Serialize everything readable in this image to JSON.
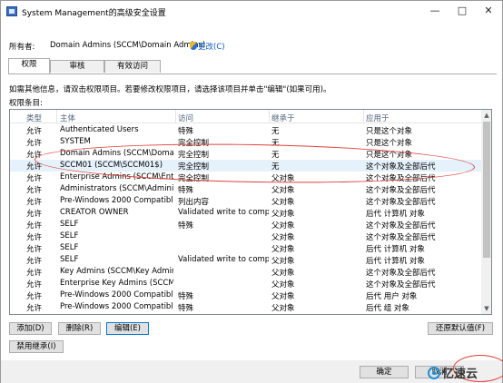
{
  "window": {
    "title": "System Management的高级安全设置"
  },
  "owner": {
    "label": "所有者:",
    "value": "Domain Admins (SCCM\\Domain Admins)",
    "change_link": "更改(C)"
  },
  "tabs": [
    "权限",
    "审核",
    "有效访问"
  ],
  "info_text": "如需其他信息，请双击权限项目。若要修改权限项目，请选择该项目并单击\"编辑\"(如果可用)。",
  "entries_label": "权限条目:",
  "columns": [
    "类型",
    "主体",
    "访问",
    "继承于",
    "应用于"
  ],
  "rows": [
    {
      "type": "允许",
      "principal": "Authenticated Users",
      "access": "特殊",
      "inherited": "无",
      "applies": "只是这个对象"
    },
    {
      "type": "允许",
      "principal": "SYSTEM",
      "access": "完全控制",
      "inherited": "无",
      "applies": "只是这个对象"
    },
    {
      "type": "允许",
      "principal": "Domain Admins (SCCM\\Domain...",
      "access": "完全控制",
      "inherited": "无",
      "applies": "只是这个对象"
    },
    {
      "type": "允许",
      "principal": "SCCM01 (SCCM\\SCCM01$)",
      "access": "完全控制",
      "inherited": "无",
      "applies": "这个对象及全部后代"
    },
    {
      "type": "允许",
      "principal": "Enterprise Admins (SCCM\\Enter...",
      "access": "完全控制",
      "inherited": "父对象",
      "applies": "这个对象及全部后代"
    },
    {
      "type": "允许",
      "principal": "Administrators (SCCM\\Administ...",
      "access": "特殊",
      "inherited": "父对象",
      "applies": "这个对象及全部后代"
    },
    {
      "type": "允许",
      "principal": "Pre-Windows 2000 Compatible ...",
      "access": "列出内容",
      "inherited": "父对象",
      "applies": "这个对象及全部后代"
    },
    {
      "type": "允许",
      "principal": "CREATOR OWNER",
      "access": "Validated write to comp...",
      "inherited": "父对象",
      "applies": "后代 计算机 对象"
    },
    {
      "type": "允许",
      "principal": "SELF",
      "access": "特殊",
      "inherited": "父对象",
      "applies": "这个对象及全部后代"
    },
    {
      "type": "允许",
      "principal": "SELF",
      "access": "",
      "inherited": "父对象",
      "applies": "这个对象及全部后代"
    },
    {
      "type": "允许",
      "principal": "SELF",
      "access": "",
      "inherited": "父对象",
      "applies": "后代 计算机 对象"
    },
    {
      "type": "允许",
      "principal": "SELF",
      "access": "Validated write to comp...",
      "inherited": "父对象",
      "applies": "后代 计算机 对象"
    },
    {
      "type": "允许",
      "principal": "Key Admins (SCCM\\Key Admins)",
      "access": "",
      "inherited": "父对象",
      "applies": "这个对象及全部后代"
    },
    {
      "type": "允许",
      "principal": "Enterprise Key Admins (SCCM\\E...",
      "access": "",
      "inherited": "父对象",
      "applies": "这个对象及全部后代"
    },
    {
      "type": "允许",
      "principal": "Pre-Windows 2000 Compatible ...",
      "access": "特殊",
      "inherited": "父对象",
      "applies": "后代 用户 对象"
    },
    {
      "type": "允许",
      "principal": "Pre-Windows 2000 Compatible ...",
      "access": "特殊",
      "inherited": "父对象",
      "applies": "后代 组 对象"
    }
  ],
  "buttons": {
    "add": "添加(D)",
    "remove": "删除(R)",
    "edit": "编辑(E)",
    "restore": "还原默认值(F)",
    "disable_inheritance": "禁用继承(I)",
    "ok": "确定",
    "cancel": "取消"
  },
  "watermark": {
    "text": "亿速云"
  },
  "colors": {
    "link": "#0b57c2",
    "selected_row": "#e5f1fb",
    "annotation": "#e0403a"
  }
}
